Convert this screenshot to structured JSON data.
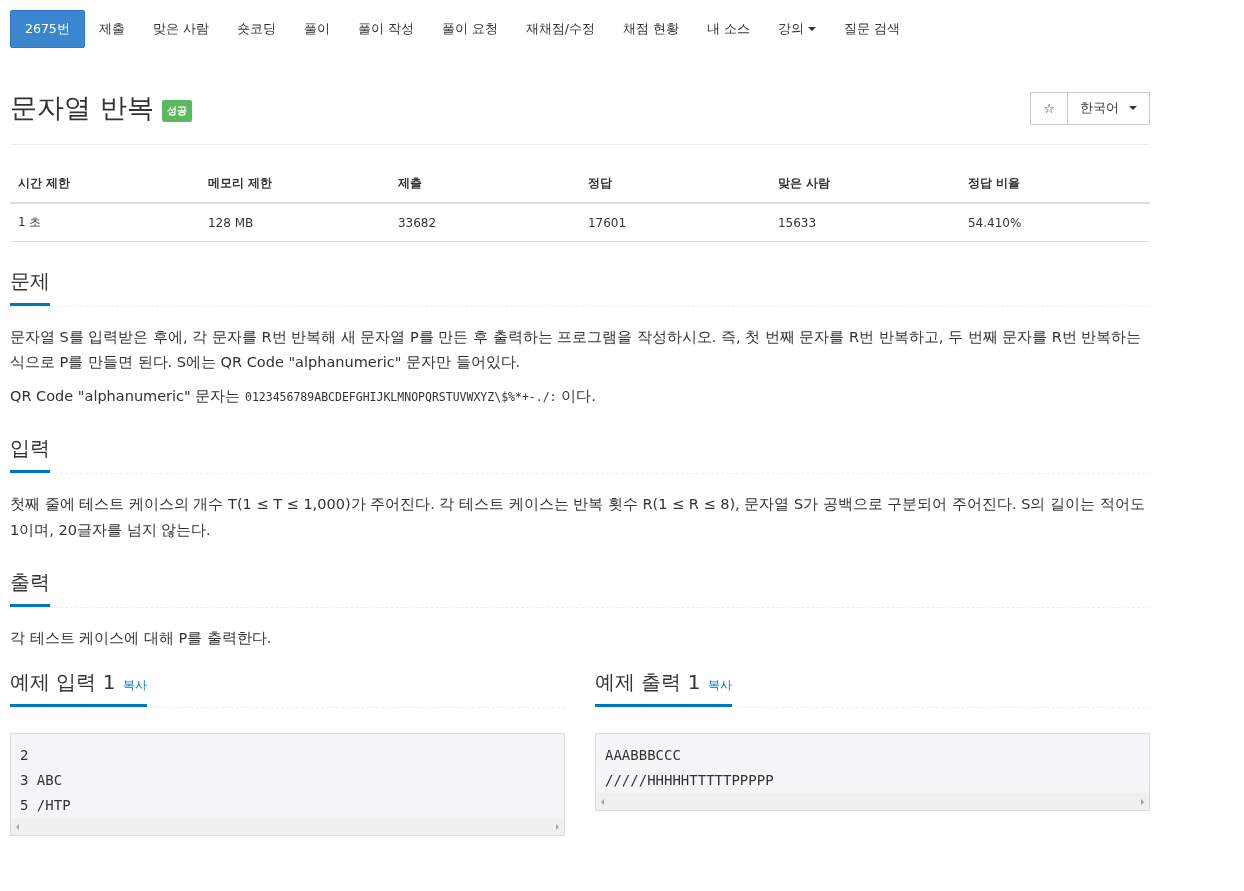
{
  "nav": [
    {
      "label": "2675번",
      "selected": true,
      "dropdown": false
    },
    {
      "label": "제출",
      "selected": false,
      "dropdown": false
    },
    {
      "label": "맞은 사람",
      "selected": false,
      "dropdown": false
    },
    {
      "label": "숏코딩",
      "selected": false,
      "dropdown": false
    },
    {
      "label": "풀이",
      "selected": false,
      "dropdown": false
    },
    {
      "label": "풀이 작성",
      "selected": false,
      "dropdown": false
    },
    {
      "label": "풀이 요청",
      "selected": false,
      "dropdown": false
    },
    {
      "label": "재채점/수정",
      "selected": false,
      "dropdown": false
    },
    {
      "label": "채점 현황",
      "selected": false,
      "dropdown": false
    },
    {
      "label": "내 소스",
      "selected": false,
      "dropdown": false
    },
    {
      "label": "강의",
      "selected": false,
      "dropdown": true
    },
    {
      "label": "질문 검색",
      "selected": false,
      "dropdown": false
    }
  ],
  "title": "문자열 반복",
  "result_badge": "성공",
  "favorite_button": "☆",
  "language_button": "한국어",
  "info_table": {
    "columns": [
      "시간 제한",
      "메모리 제한",
      "제출",
      "정답",
      "맞은 사람",
      "정답 비율"
    ],
    "rows": [
      [
        "1 초",
        "128 MB",
        "33682",
        "17601",
        "15633",
        "54.410%"
      ]
    ]
  },
  "sections": [
    {
      "heading": "문제",
      "paragraphs": [
        {
          "parts": [
            {
              "kind": "text",
              "text": "문자열 S를 입력받은 후에, 각 문자를 R번 반복해 새 문자열 P를 만든 후 출력하는 프로그램을 작성하시오. 즉, 첫 번째 문자를 R번 반복하고, 두 번째 문자를 R번 반복하는 식으로 P를 만들면 된다. S에는 QR Code \"alphanumeric\" 문자만 들어있다."
            }
          ]
        },
        {
          "parts": [
            {
              "kind": "text",
              "text": "QR Code \"alphanumeric\" 문자는 "
            },
            {
              "kind": "code",
              "text": "0123456789ABCDEFGHIJKLMNOPQRSTUVWXYZ\\$%*+-./:"
            },
            {
              "kind": "text",
              "text": " 이다."
            }
          ]
        }
      ]
    },
    {
      "heading": "입력",
      "paragraphs": [
        {
          "parts": [
            {
              "kind": "text",
              "text": "첫째 줄에 테스트 케이스의 개수 T(1 ≤ T ≤ 1,000)가 주어진다. 각 테스트 케이스는 반복 횟수 R(1 ≤ R ≤ 8), 문자열 S가 공백으로 구분되어 주어진다. S의 길이는 적어도 1이며, 20글자를 넘지 않는다."
            }
          ]
        }
      ]
    },
    {
      "heading": "출력",
      "paragraphs": [
        {
          "parts": [
            {
              "kind": "text",
              "text": "각 테스트 케이스에 대해 P를 출력한다."
            }
          ]
        }
      ]
    }
  ],
  "samples": [
    {
      "heading": "예제 입력 1",
      "copy_link": "복사",
      "lines": [
        "2",
        "3 ABC",
        "5 /HTP"
      ]
    },
    {
      "heading": "예제 출력 1",
      "copy_link": "복사",
      "lines": [
        "AAABBBCCC",
        "/////HHHHHTTTTTPPPPP"
      ]
    }
  ]
}
